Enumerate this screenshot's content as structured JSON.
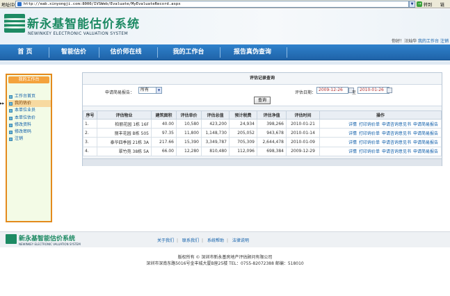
{
  "browser": {
    "address_label": "地址(D)",
    "url": "http://eab.xinyongji.com:8000/IVSWeb/Evaluate/MyEvaluateRecord.aspx",
    "go_label": "转到",
    "links_label": "链"
  },
  "header": {
    "logo_cn": "新永基智能估价系统",
    "logo_en": "NEWINKEY ELECTRONIC VALUATION SYSTEM",
    "welcome_prefix": "你好！",
    "user_name": "汪灿华",
    "my_desk_link": "我的工作台",
    "logout_link": "注销"
  },
  "nav": {
    "items": [
      "首 页",
      "智能估价",
      "估价师在线",
      "我的工作台",
      "报告真伪查询"
    ]
  },
  "sidebar": {
    "title": "我的工作台",
    "items": [
      "工作台首页",
      "我的估价",
      "本单位业员",
      "本单位估价",
      "修改资料",
      "修改密码",
      "注销"
    ]
  },
  "panel": {
    "title": "评估记录查询",
    "report_label": "申请简易报告：",
    "report_value": "所有",
    "date_label": "评估日期：",
    "date_from": "2009-12-26",
    "date_to_label": "至",
    "date_to": "2010-01-26",
    "search_button": "查询"
  },
  "table": {
    "headers": [
      "序号",
      "评估物业",
      "建筑面积",
      "评估单价",
      "评估总值",
      "预计税费",
      "评估净值",
      "评估时间",
      "操作"
    ],
    "rows": [
      [
        "1.",
        "柏丽花园 1栋 16F",
        "40.00",
        "10,580",
        "423,200",
        "24,934",
        "398,266",
        "2010-01-21"
      ],
      [
        "2.",
        "丽丰花园 B栋 505",
        "97.35",
        "11,800",
        "1,148,730",
        "205,052",
        "943,678",
        "2010-01-14"
      ],
      [
        "3.",
        "泰华四季园 21栋 3A",
        "217.66",
        "15,390",
        "3,349,787",
        "705,309",
        "2,644,478",
        "2010-01-09"
      ],
      [
        "4.",
        "翠竹苑 38栋 5A",
        "66.00",
        "12,280",
        "810,480",
        "112,096",
        "698,384",
        "2009-12-29"
      ]
    ],
    "ops": [
      "详情",
      "打印询价单",
      "申请咨询意见书",
      "申请简易报告"
    ]
  },
  "footer": {
    "logo_cn": "新永基智能估价系统",
    "logo_en": "NEWINKEY ELECTRONIC VALUATION SYSTEM",
    "links": [
      "关于我们",
      "联系我们",
      "系统帮助",
      "法律说明"
    ],
    "copyright": "版权所有 © 深圳市新永基房地产评估顾问有限公司",
    "address": "深圳市深南东路5016号金丰城大厦B座25楼  TEL：0755-82072388  邮编：518010"
  }
}
